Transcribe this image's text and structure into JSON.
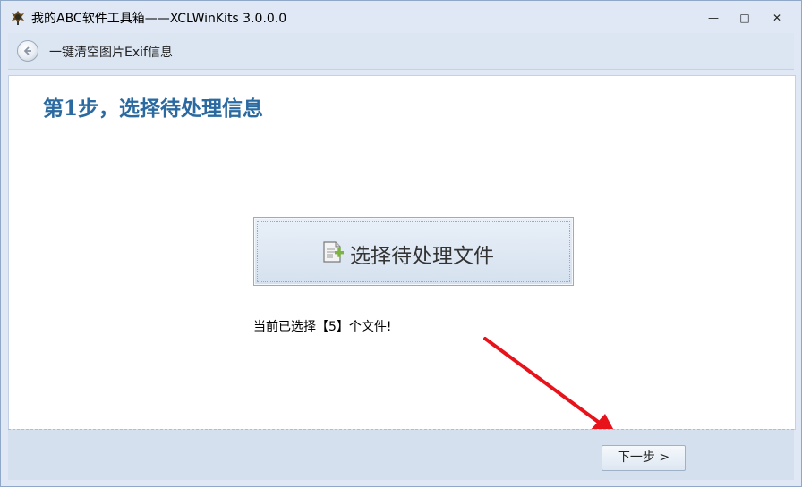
{
  "window": {
    "title": "我的ABC软件工具箱——XCLWinKits  3.0.0.0",
    "minimize_glyph": "—",
    "maximize_glyph": "□",
    "close_glyph": "✕"
  },
  "breadcrumb": {
    "label": "一键清空图片Exif信息",
    "back_icon": "back-arrow-icon"
  },
  "main": {
    "step_title": "第1步，选择待处理信息",
    "select_button_label": "选择待处理文件",
    "select_button_icon": "add-file-icon",
    "status_text": "当前已选择【5】个文件!"
  },
  "footer": {
    "next_button_label": "下一步 >"
  },
  "colors": {
    "accent_title": "#2a6aa0",
    "annotation_arrow": "#e8121b",
    "window_bg": "#dfe8f4"
  }
}
